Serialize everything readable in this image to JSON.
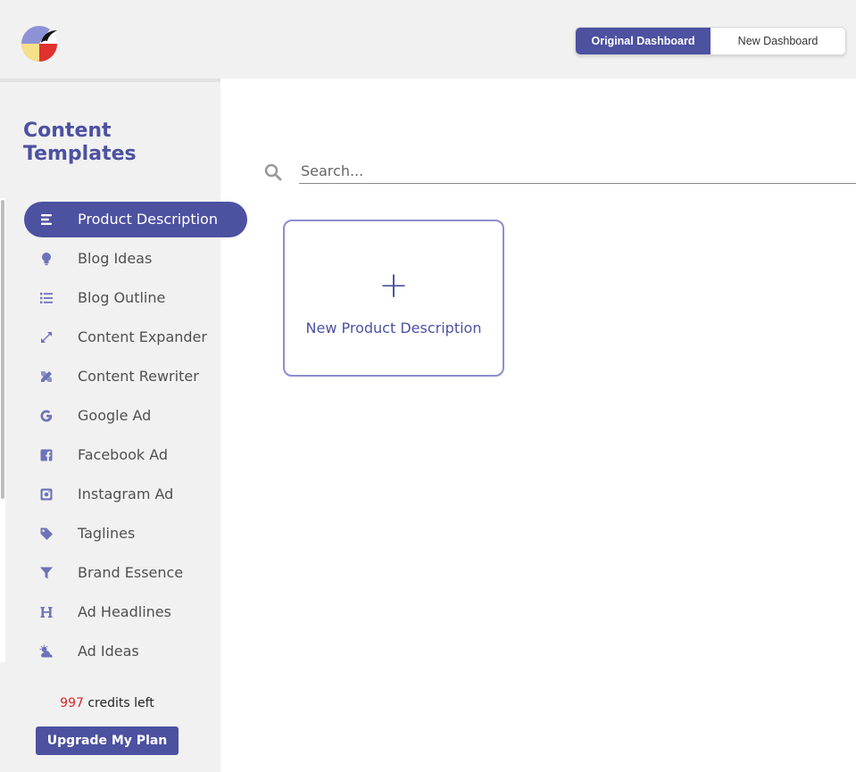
{
  "header": {
    "toggle": {
      "original_label": "Original Dashboard",
      "new_label": "New Dashboard",
      "selected": "Original Dashboard"
    }
  },
  "sidebar": {
    "title": "Content Templates",
    "items": [
      {
        "label": "Product Description",
        "icon": "align-left-icon",
        "active": true
      },
      {
        "label": "Blog Ideas",
        "icon": "lightbulb-icon",
        "active": false
      },
      {
        "label": "Blog Outline",
        "icon": "list-icon",
        "active": false
      },
      {
        "label": "Content Expander",
        "icon": "expand-arrows-icon",
        "active": false
      },
      {
        "label": "Content Rewriter",
        "icon": "pencil-ruler-icon",
        "active": false
      },
      {
        "label": "Google Ad",
        "icon": "google-icon",
        "active": false
      },
      {
        "label": "Facebook Ad",
        "icon": "facebook-icon",
        "active": false
      },
      {
        "label": "Instagram Ad",
        "icon": "instagram-icon",
        "active": false
      },
      {
        "label": "Taglines",
        "icon": "tag-icon",
        "active": false
      },
      {
        "label": "Brand Essence",
        "icon": "filter-icon",
        "active": false
      },
      {
        "label": "Ad Headlines",
        "icon": "heading-icon",
        "active": false
      },
      {
        "label": "Ad Ideas",
        "icon": "cloud-sun-icon",
        "active": false
      }
    ],
    "credits_count": "997",
    "credits_suffix": " credits left",
    "upgrade_label": "Upgrade My Plan"
  },
  "main": {
    "search_placeholder": "Search...",
    "new_card_plus": "+",
    "new_card_label": "New Product Description"
  },
  "colors": {
    "accent": "#4c51a0",
    "card_border": "#8a8ed0",
    "credits_red": "#d8242b",
    "sidebar_bg": "#f1f1f1"
  }
}
